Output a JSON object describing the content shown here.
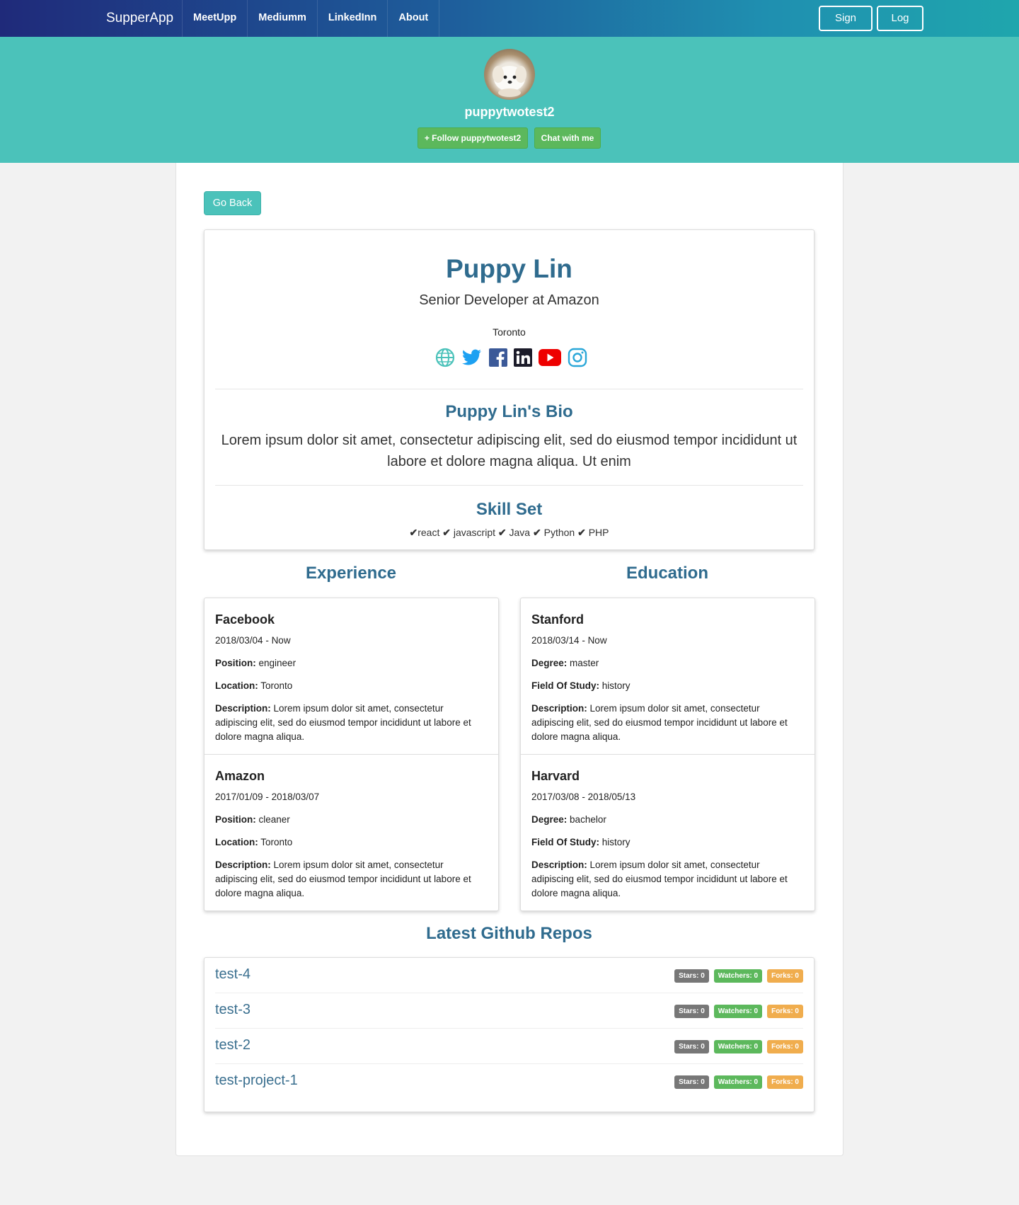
{
  "nav": {
    "brand": "SupperApp",
    "links": [
      "MeetUpp",
      "Mediumm",
      "LinkedInn",
      "About"
    ],
    "signup": "Sign up",
    "login": "Log In"
  },
  "header": {
    "username": "puppytwotest2",
    "follow": "+ Follow puppytwotest2",
    "chat": "Chat with me"
  },
  "go_back": "Go Back",
  "profile": {
    "name": "Puppy Lin",
    "title": "Senior Developer at Amazon",
    "location": "Toronto",
    "socials": [
      "globe-icon",
      "twitter-icon",
      "facebook-icon",
      "linkedin-icon",
      "youtube-icon",
      "instagram-icon"
    ],
    "bio_heading": "Puppy Lin's Bio",
    "bio": "Lorem ipsum dolor sit amet, consectetur adipiscing elit, sed do eiusmod tempor incididunt ut labore et dolore magna aliqua. Ut enim",
    "skills_heading": "Skill Set",
    "skills": [
      "react",
      "javascript",
      "Java",
      "Python",
      "PHP"
    ]
  },
  "experience": {
    "heading": "Experience",
    "items": [
      {
        "company": "Facebook",
        "dates": "2018/03/04 - Now",
        "position_label": "Position:",
        "position": "engineer",
        "location_label": "Location:",
        "location": "Toronto",
        "description_label": "Description:",
        "description": "Lorem ipsum dolor sit amet, consectetur adipiscing elit, sed do eiusmod tempor incididunt ut labore et dolore magna aliqua."
      },
      {
        "company": "Amazon",
        "dates": "2017/01/09 - 2018/03/07",
        "position_label": "Position:",
        "position": "cleaner",
        "location_label": "Location:",
        "location": "Toronto",
        "description_label": "Description:",
        "description": "Lorem ipsum dolor sit amet, consectetur adipiscing elit, sed do eiusmod tempor incididunt ut labore et dolore magna aliqua."
      }
    ]
  },
  "education": {
    "heading": "Education",
    "items": [
      {
        "school": "Stanford",
        "dates": "2018/03/14 - Now",
        "degree_label": "Degree:",
        "degree": "master",
        "field_label": "Field Of Study:",
        "field": "history",
        "description_label": "Description:",
        "description": "Lorem ipsum dolor sit amet, consectetur adipiscing elit, sed do eiusmod tempor incididunt ut labore et dolore magna aliqua."
      },
      {
        "school": "Harvard",
        "dates": "2017/03/08 - 2018/05/13",
        "degree_label": "Degree:",
        "degree": "bachelor",
        "field_label": "Field Of Study:",
        "field": "history",
        "description_label": "Description:",
        "description": "Lorem ipsum dolor sit amet, consectetur adipiscing elit, sed do eiusmod tempor incididunt ut labore et dolore magna aliqua."
      }
    ]
  },
  "repos": {
    "heading": "Latest Github Repos",
    "items": [
      {
        "name": "test-4",
        "stars": "Stars: 0",
        "watchers": "Watchers: 0",
        "forks": "Forks: 0"
      },
      {
        "name": "test-3",
        "stars": "Stars: 0",
        "watchers": "Watchers: 0",
        "forks": "Forks: 0"
      },
      {
        "name": "test-2",
        "stars": "Stars: 0",
        "watchers": "Watchers: 0",
        "forks": "Forks: 0"
      },
      {
        "name": "test-project-1",
        "stars": "Stars: 0",
        "watchers": "Watchers: 0",
        "forks": "Forks: 0"
      }
    ]
  },
  "colors": {
    "nav_gradient_start": "#1f2a7a",
    "nav_gradient_end": "#1fa6ad",
    "teal": "#4bc2ba",
    "heading_blue": "#2f6b8e",
    "success_green": "#5cb85c",
    "badge_gray": "#777777",
    "badge_orange": "#f0ad4e"
  }
}
